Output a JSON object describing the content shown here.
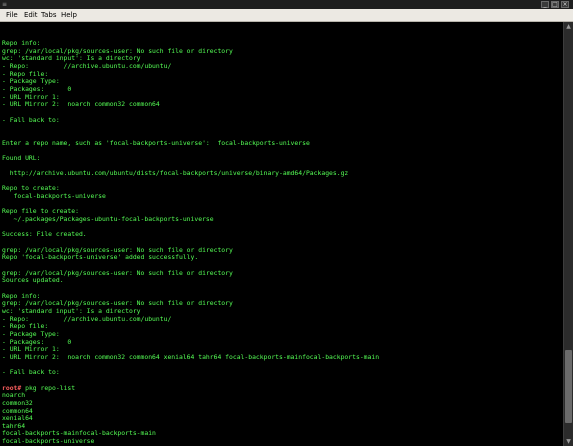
{
  "window": {
    "app_icon": "≡"
  },
  "menubar": {
    "items": [
      "File",
      "Edit",
      "Tabs",
      "Help"
    ]
  },
  "terminal": {
    "prompt": "root#",
    "scroll_position": 0.96,
    "scroll_visible_fraction": 0.18,
    "lines": [
      {
        "prompt": false,
        "text": "Repo info:"
      },
      {
        "prompt": false,
        "text": "grep: /var/local/pkg/sources-user: No such file or directory"
      },
      {
        "prompt": false,
        "text": "wc: 'standard input': Is a directory"
      },
      {
        "prompt": false,
        "text": "- Repo:         //archive.ubuntu.com/ubuntu/"
      },
      {
        "prompt": false,
        "text": "- Repo file:"
      },
      {
        "prompt": false,
        "text": "- Package Type:"
      },
      {
        "prompt": false,
        "text": "- Packages:      0"
      },
      {
        "prompt": false,
        "text": "- URL Mirror 1:"
      },
      {
        "prompt": false,
        "text": "- URL Mirror 2:  noarch common32 common64"
      },
      {
        "prompt": false,
        "text": ""
      },
      {
        "prompt": false,
        "text": "- Fall back to:"
      },
      {
        "prompt": false,
        "text": ""
      },
      {
        "prompt": false,
        "text": ""
      },
      {
        "prompt": false,
        "text": "Enter a repo name, such as 'focal-backports-universe':  focal-backports-universe"
      },
      {
        "prompt": false,
        "text": ""
      },
      {
        "prompt": false,
        "text": "Found URL:"
      },
      {
        "prompt": false,
        "text": ""
      },
      {
        "prompt": false,
        "text": "  http://archive.ubuntu.com/ubuntu/dists/focal-backports/universe/binary-amd64/Packages.gz"
      },
      {
        "prompt": false,
        "text": ""
      },
      {
        "prompt": false,
        "text": "Repo to create:"
      },
      {
        "prompt": false,
        "text": "   focal-backports-universe"
      },
      {
        "prompt": false,
        "text": ""
      },
      {
        "prompt": false,
        "text": "Repo file to create:"
      },
      {
        "prompt": false,
        "text": "   ~/.packages/Packages-ubuntu-focal-backports-universe"
      },
      {
        "prompt": false,
        "text": ""
      },
      {
        "prompt": false,
        "text": "Success: File created."
      },
      {
        "prompt": false,
        "text": ""
      },
      {
        "prompt": false,
        "text": "grep: /var/local/pkg/sources-user: No such file or directory"
      },
      {
        "prompt": false,
        "text": "Repo 'focal-backports-universe' added successfully."
      },
      {
        "prompt": false,
        "text": ""
      },
      {
        "prompt": false,
        "text": "grep: /var/local/pkg/sources-user: No such file or directory"
      },
      {
        "prompt": false,
        "text": "Sources updated."
      },
      {
        "prompt": false,
        "text": ""
      },
      {
        "prompt": false,
        "text": "Repo info:"
      },
      {
        "prompt": false,
        "text": "grep: /var/local/pkg/sources-user: No such file or directory"
      },
      {
        "prompt": false,
        "text": "wc: 'standard input': Is a directory"
      },
      {
        "prompt": false,
        "text": "- Repo:         //archive.ubuntu.com/ubuntu/"
      },
      {
        "prompt": false,
        "text": "- Repo file:"
      },
      {
        "prompt": false,
        "text": "- Package Type:"
      },
      {
        "prompt": false,
        "text": "- Packages:      0"
      },
      {
        "prompt": false,
        "text": "- URL Mirror 1:"
      },
      {
        "prompt": false,
        "text": "- URL Mirror 2:  noarch common32 common64 xenial64 tahr64 focal-backports-mainfocal-backports-main"
      },
      {
        "prompt": false,
        "text": ""
      },
      {
        "prompt": false,
        "text": "- Fall back to:"
      },
      {
        "prompt": false,
        "text": ""
      },
      {
        "prompt": true,
        "text": " pkg repo-list"
      },
      {
        "prompt": false,
        "text": "noarch"
      },
      {
        "prompt": false,
        "text": "common32"
      },
      {
        "prompt": false,
        "text": "common64"
      },
      {
        "prompt": false,
        "text": "xenial64"
      },
      {
        "prompt": false,
        "text": "tahr64"
      },
      {
        "prompt": false,
        "text": "focal-backports-mainfocal-backports-main"
      },
      {
        "prompt": false,
        "text": "focal-backports-universe"
      },
      {
        "prompt": true,
        "text": " ",
        "cursor": true
      }
    ]
  },
  "colors": {
    "output_text": "#55ff55",
    "prompt": "#ff5f5f",
    "background": "#000000",
    "menubar": "#ece9e3"
  },
  "icons": {
    "minimize": "minimize-icon",
    "maximize": "maximize-icon",
    "close": "close-icon",
    "scroll_up": "scroll-up-arrow-icon",
    "scroll_down": "scroll-down-arrow-icon"
  }
}
